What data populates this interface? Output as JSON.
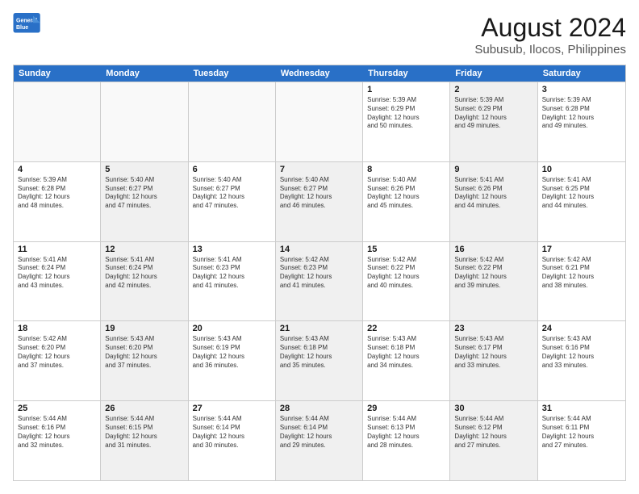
{
  "header": {
    "logo_line1": "General",
    "logo_line2": "Blue",
    "main_title": "August 2024",
    "subtitle": "Subusub, Ilocos, Philippines"
  },
  "days_of_week": [
    "Sunday",
    "Monday",
    "Tuesday",
    "Wednesday",
    "Thursday",
    "Friday",
    "Saturday"
  ],
  "weeks": [
    [
      {
        "day": "",
        "info": "",
        "empty": true
      },
      {
        "day": "",
        "info": "",
        "empty": true
      },
      {
        "day": "",
        "info": "",
        "empty": true
      },
      {
        "day": "",
        "info": "",
        "empty": true
      },
      {
        "day": "1",
        "info": "Sunrise: 5:39 AM\nSunset: 6:29 PM\nDaylight: 12 hours\nand 50 minutes.",
        "shaded": false
      },
      {
        "day": "2",
        "info": "Sunrise: 5:39 AM\nSunset: 6:29 PM\nDaylight: 12 hours\nand 49 minutes.",
        "shaded": true
      },
      {
        "day": "3",
        "info": "Sunrise: 5:39 AM\nSunset: 6:28 PM\nDaylight: 12 hours\nand 49 minutes.",
        "shaded": false
      }
    ],
    [
      {
        "day": "4",
        "info": "Sunrise: 5:39 AM\nSunset: 6:28 PM\nDaylight: 12 hours\nand 48 minutes.",
        "shaded": false
      },
      {
        "day": "5",
        "info": "Sunrise: 5:40 AM\nSunset: 6:27 PM\nDaylight: 12 hours\nand 47 minutes.",
        "shaded": true
      },
      {
        "day": "6",
        "info": "Sunrise: 5:40 AM\nSunset: 6:27 PM\nDaylight: 12 hours\nand 47 minutes.",
        "shaded": false
      },
      {
        "day": "7",
        "info": "Sunrise: 5:40 AM\nSunset: 6:27 PM\nDaylight: 12 hours\nand 46 minutes.",
        "shaded": true
      },
      {
        "day": "8",
        "info": "Sunrise: 5:40 AM\nSunset: 6:26 PM\nDaylight: 12 hours\nand 45 minutes.",
        "shaded": false
      },
      {
        "day": "9",
        "info": "Sunrise: 5:41 AM\nSunset: 6:26 PM\nDaylight: 12 hours\nand 44 minutes.",
        "shaded": true
      },
      {
        "day": "10",
        "info": "Sunrise: 5:41 AM\nSunset: 6:25 PM\nDaylight: 12 hours\nand 44 minutes.",
        "shaded": false
      }
    ],
    [
      {
        "day": "11",
        "info": "Sunrise: 5:41 AM\nSunset: 6:24 PM\nDaylight: 12 hours\nand 43 minutes.",
        "shaded": false
      },
      {
        "day": "12",
        "info": "Sunrise: 5:41 AM\nSunset: 6:24 PM\nDaylight: 12 hours\nand 42 minutes.",
        "shaded": true
      },
      {
        "day": "13",
        "info": "Sunrise: 5:41 AM\nSunset: 6:23 PM\nDaylight: 12 hours\nand 41 minutes.",
        "shaded": false
      },
      {
        "day": "14",
        "info": "Sunrise: 5:42 AM\nSunset: 6:23 PM\nDaylight: 12 hours\nand 41 minutes.",
        "shaded": true
      },
      {
        "day": "15",
        "info": "Sunrise: 5:42 AM\nSunset: 6:22 PM\nDaylight: 12 hours\nand 40 minutes.",
        "shaded": false
      },
      {
        "day": "16",
        "info": "Sunrise: 5:42 AM\nSunset: 6:22 PM\nDaylight: 12 hours\nand 39 minutes.",
        "shaded": true
      },
      {
        "day": "17",
        "info": "Sunrise: 5:42 AM\nSunset: 6:21 PM\nDaylight: 12 hours\nand 38 minutes.",
        "shaded": false
      }
    ],
    [
      {
        "day": "18",
        "info": "Sunrise: 5:42 AM\nSunset: 6:20 PM\nDaylight: 12 hours\nand 37 minutes.",
        "shaded": false
      },
      {
        "day": "19",
        "info": "Sunrise: 5:43 AM\nSunset: 6:20 PM\nDaylight: 12 hours\nand 37 minutes.",
        "shaded": true
      },
      {
        "day": "20",
        "info": "Sunrise: 5:43 AM\nSunset: 6:19 PM\nDaylight: 12 hours\nand 36 minutes.",
        "shaded": false
      },
      {
        "day": "21",
        "info": "Sunrise: 5:43 AM\nSunset: 6:18 PM\nDaylight: 12 hours\nand 35 minutes.",
        "shaded": true
      },
      {
        "day": "22",
        "info": "Sunrise: 5:43 AM\nSunset: 6:18 PM\nDaylight: 12 hours\nand 34 minutes.",
        "shaded": false
      },
      {
        "day": "23",
        "info": "Sunrise: 5:43 AM\nSunset: 6:17 PM\nDaylight: 12 hours\nand 33 minutes.",
        "shaded": true
      },
      {
        "day": "24",
        "info": "Sunrise: 5:43 AM\nSunset: 6:16 PM\nDaylight: 12 hours\nand 33 minutes.",
        "shaded": false
      }
    ],
    [
      {
        "day": "25",
        "info": "Sunrise: 5:44 AM\nSunset: 6:16 PM\nDaylight: 12 hours\nand 32 minutes.",
        "shaded": false
      },
      {
        "day": "26",
        "info": "Sunrise: 5:44 AM\nSunset: 6:15 PM\nDaylight: 12 hours\nand 31 minutes.",
        "shaded": true
      },
      {
        "day": "27",
        "info": "Sunrise: 5:44 AM\nSunset: 6:14 PM\nDaylight: 12 hours\nand 30 minutes.",
        "shaded": false
      },
      {
        "day": "28",
        "info": "Sunrise: 5:44 AM\nSunset: 6:14 PM\nDaylight: 12 hours\nand 29 minutes.",
        "shaded": true
      },
      {
        "day": "29",
        "info": "Sunrise: 5:44 AM\nSunset: 6:13 PM\nDaylight: 12 hours\nand 28 minutes.",
        "shaded": false
      },
      {
        "day": "30",
        "info": "Sunrise: 5:44 AM\nSunset: 6:12 PM\nDaylight: 12 hours\nand 27 minutes.",
        "shaded": true
      },
      {
        "day": "31",
        "info": "Sunrise: 5:44 AM\nSunset: 6:11 PM\nDaylight: 12 hours\nand 27 minutes.",
        "shaded": false
      }
    ]
  ]
}
